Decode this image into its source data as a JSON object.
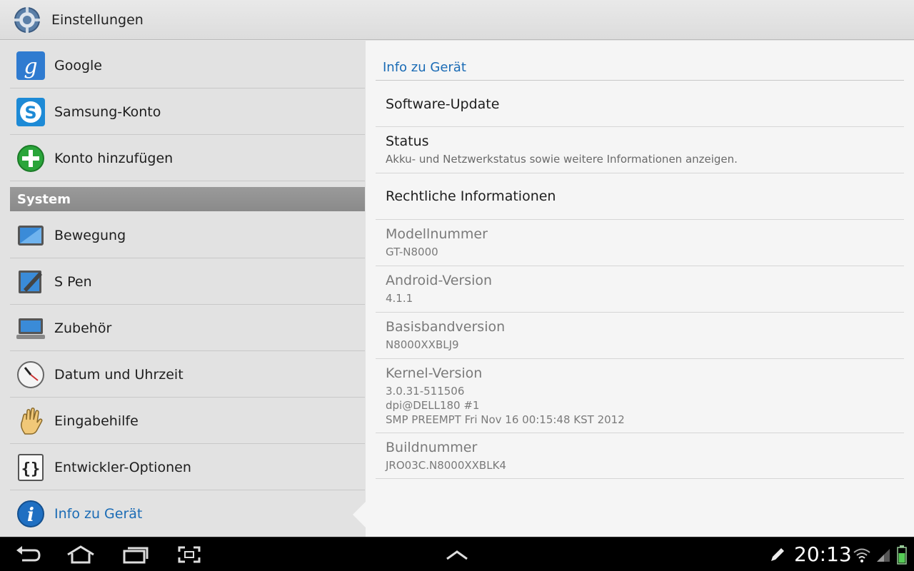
{
  "header": {
    "title": "Einstellungen",
    "icon": "settings-gear-icon"
  },
  "left": {
    "items": [
      {
        "label": "Google",
        "icon": "google-icon"
      },
      {
        "label": "Samsung-Konto",
        "icon": "samsung-account-icon"
      },
      {
        "label": "Konto hinzufügen",
        "icon": "add-account-icon"
      }
    ],
    "section": "System",
    "system_items": [
      {
        "label": "Bewegung",
        "icon": "motion-icon"
      },
      {
        "label": "S Pen",
        "icon": "s-pen-icon"
      },
      {
        "label": "Zubehör",
        "icon": "accessory-icon"
      },
      {
        "label": "Datum und Uhrzeit",
        "icon": "clock-icon"
      },
      {
        "label": "Eingabehilfe",
        "icon": "hand-icon"
      },
      {
        "label": "Entwickler-Optionen",
        "icon": "developer-braces-icon"
      },
      {
        "label": "Info zu Gerät",
        "icon": "info-icon"
      }
    ]
  },
  "right": {
    "header": "Info zu Gerät",
    "items": [
      {
        "title": "Software-Update"
      },
      {
        "title": "Status",
        "sub": "Akku- und Netzwerkstatus sowie weitere Informationen anzeigen."
      },
      {
        "title": "Rechtliche Informationen"
      },
      {
        "title": "Modellnummer",
        "sub": "GT-N8000"
      },
      {
        "title": "Android-Version",
        "sub": "4.1.1"
      },
      {
        "title": "Basisbandversion",
        "sub": "N8000XXBLJ9"
      },
      {
        "title": "Kernel-Version",
        "sub1": "3.0.31-511506",
        "sub2": "dpi@DELL180 #1",
        "sub3": "SMP PREEMPT Fri Nov 16 00:15:48 KST 2012"
      },
      {
        "title": "Buildnummer",
        "sub": "JRO03C.N8000XXBLK4"
      }
    ]
  },
  "navbar": {
    "time": "20:13",
    "buttons": [
      "back-icon",
      "home-icon",
      "recent-apps-icon",
      "screenshot-icon",
      "up-chevron-icon"
    ],
    "status_icons": [
      "pen-icon",
      "wifi-icon",
      "signal-icon",
      "battery-icon"
    ]
  },
  "colors": {
    "accent": "#1a6bb5",
    "section_bg": "#8f8f8f",
    "navbar_bg": "#000000"
  }
}
